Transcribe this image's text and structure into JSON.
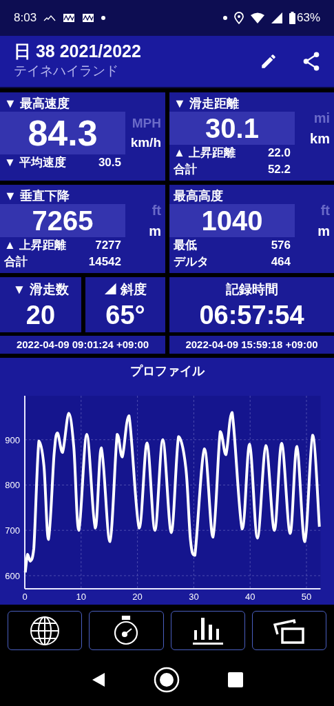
{
  "status_bar": {
    "time": "8:03",
    "battery": "63%"
  },
  "header": {
    "title": "日 38 2021/2022",
    "subtitle": "テイネハイランド"
  },
  "metrics": [
    {
      "title": "▼ 最高速度",
      "value": "84.3",
      "units": [
        {
          "label": "MPH",
          "selected": false
        },
        {
          "label": "km/h",
          "selected": true
        }
      ],
      "rows": [
        {
          "label": "▼ 平均速度",
          "value": "30.5"
        }
      ]
    },
    {
      "title": "▼ 滑走距離",
      "value": "30.1",
      "units": [
        {
          "label": "mi",
          "selected": false
        },
        {
          "label": "km",
          "selected": true
        }
      ],
      "rows": [
        {
          "label": "▲ 上昇距離",
          "value": "22.0"
        },
        {
          "label": "合計",
          "value": "52.2"
        }
      ]
    },
    {
      "title": "▼ 垂直下降",
      "value": "7265",
      "units": [
        {
          "label": "ft",
          "selected": false
        },
        {
          "label": "m",
          "selected": true
        }
      ],
      "rows": [
        {
          "label": "▲ 上昇距離",
          "value": "7277"
        },
        {
          "label": "合計",
          "value": "14542"
        }
      ]
    },
    {
      "title": "最高高度",
      "value": "1040",
      "units": [
        {
          "label": "ft",
          "selected": false
        },
        {
          "label": "m",
          "selected": true
        }
      ],
      "rows": [
        {
          "label": "最低",
          "value": "576"
        },
        {
          "label": "デルタ",
          "value": "464"
        }
      ]
    }
  ],
  "summary": [
    {
      "title": "▼ 滑走数",
      "value": "20"
    },
    {
      "title": "◢ 斜度",
      "value": "65°"
    },
    {
      "title": "記録時間",
      "value": "06:57:54"
    }
  ],
  "times": [
    "2022-04-09 09:01:24 +09:00",
    "2022-04-09 15:59:18 +09:00"
  ],
  "profile": {
    "title": "プロファイル",
    "chart_data": {
      "type": "line",
      "xlim": [
        0,
        52.5
      ],
      "ylim": [
        571,
        997
      ],
      "xticks": [
        0,
        10,
        20,
        30,
        40,
        50
      ],
      "yticks": [
        600,
        700,
        800,
        900
      ],
      "x": [
        0.08,
        0.5,
        0.98,
        1.6,
        2.5,
        3.4,
        4.2,
        5.2,
        5.8,
        6.7,
        7.8,
        8.7,
        9.6,
        11.0,
        12.5,
        13.6,
        15.1,
        16.4,
        17.3,
        18.5,
        20.3,
        21.7,
        23.1,
        24.5,
        26.0,
        27.3,
        28.6,
        29.4,
        30.2,
        31.9,
        33.4,
        34.7,
        35.7,
        36.8,
        38.6,
        39.9,
        41.3,
        42.8,
        44.3,
        45.6,
        47.1,
        48.3,
        49.7,
        51.1,
        52.3
      ],
      "grid": true,
      "series": [
        {
          "color": "#ffffff",
          "values": [
            607,
            647,
            632,
            660,
            897,
            842,
            680,
            867,
            915,
            872,
            958,
            883,
            700,
            912,
            705,
            882,
            675,
            912,
            862,
            953,
            705,
            893,
            700,
            900,
            695,
            907,
            837,
            680,
            645,
            880,
            685,
            918,
            867,
            960,
            703,
            890,
            683,
            887,
            700,
            892,
            693,
            885,
            675,
            910,
            708
          ]
        }
      ]
    }
  },
  "toolbar": [
    {
      "kind": "globe"
    },
    {
      "kind": "stopwatch"
    },
    {
      "kind": "bars"
    },
    {
      "kind": "cards"
    }
  ]
}
